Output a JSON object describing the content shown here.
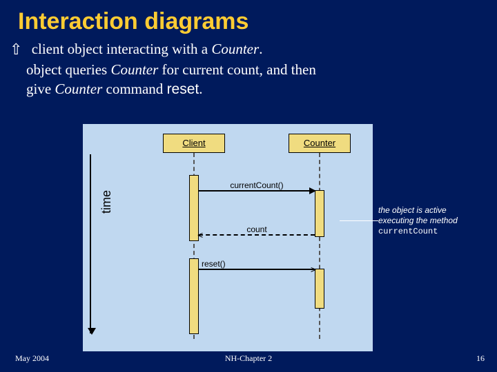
{
  "title": "Interaction diagrams",
  "bullet": {
    "line1_pre": "client object interacting with a ",
    "counter1": "Counter",
    "line1_post": ".",
    "line2_pre": "object queries ",
    "counter2": "Counter",
    "line2_mid": " for current count, and then",
    "line3_pre": "give ",
    "counter3": "Counter",
    "line3_mid": " command ",
    "reset": "reset",
    "line3_post": "."
  },
  "diagram": {
    "client_box": "Client",
    "counter_box": "Counter",
    "msg_currentCount": "currentCount()",
    "msg_return": "count",
    "msg_reset": "reset()",
    "time_label": "time"
  },
  "annotation": {
    "l1": "the object is active",
    "l2": "executing the method",
    "l3": "currentCount"
  },
  "footer": {
    "left": "May 2004",
    "center": "NH-Chapter 2",
    "right": "16"
  }
}
